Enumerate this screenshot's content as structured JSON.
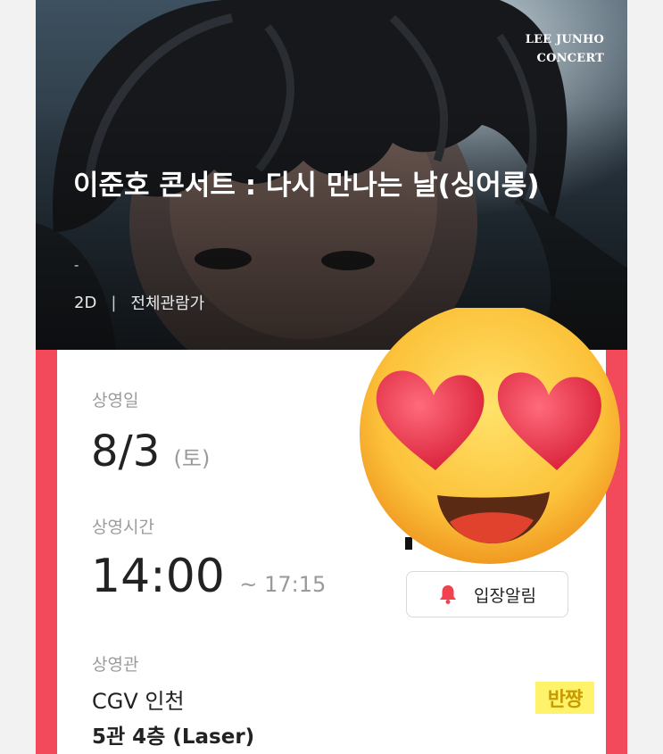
{
  "poster": {
    "brand_line1": "LEE JUNHO",
    "brand_line2": "CONCERT",
    "title": "이준호 콘서트 : 다시 만나는 날(싱어롱)",
    "subtitle_dash": "-",
    "format": "2D",
    "separator": "|",
    "rating": "전체관람가"
  },
  "ticket": {
    "date_label": "상영일",
    "date_value": "8/3",
    "date_day": "(토)",
    "time_label": "상영시간",
    "time_start": "14:00",
    "time_end": "~ 17:15",
    "entry_alert_button": "입장알림",
    "theater_label": "상영관",
    "theater_name": "CGV 인천",
    "theater_hall": "5관 4층 (Laser)"
  },
  "overlay": {
    "watermark_text": "반쨩",
    "emoji": "heart-eyes-emoji"
  },
  "colors": {
    "accent_stripe": "#f34a5b",
    "bell": "#f0424f",
    "watermark_bg": "#fff36b"
  }
}
